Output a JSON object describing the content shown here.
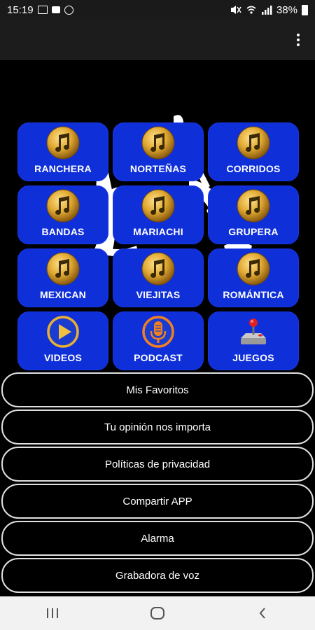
{
  "status_bar": {
    "time": "15:19",
    "battery": "38%"
  },
  "background": {
    "art_color": "#ffffff"
  },
  "tiles": [
    {
      "label": "RANCHERA",
      "icon": "music-note-icon"
    },
    {
      "label": "NORTEÑAS",
      "icon": "music-note-icon"
    },
    {
      "label": "CORRIDOS",
      "icon": "music-note-icon"
    },
    {
      "label": "BANDAS",
      "icon": "music-note-icon"
    },
    {
      "label": "MARIACHI",
      "icon": "music-note-icon"
    },
    {
      "label": "GRUPERA",
      "icon": "music-note-icon"
    },
    {
      "label": "MEXICAN",
      "icon": "music-note-icon"
    },
    {
      "label": "VIEJITAS",
      "icon": "music-note-icon"
    },
    {
      "label": "ROMÁNTICA",
      "icon": "music-note-icon"
    },
    {
      "label": "VIDEOS",
      "icon": "play-icon"
    },
    {
      "label": "PODCAST",
      "icon": "microphone-icon"
    },
    {
      "label": "JUEGOS",
      "icon": "joystick-icon"
    }
  ],
  "menu": [
    {
      "label": "Mis Favoritos"
    },
    {
      "label": "Tu opinión nos importa"
    },
    {
      "label": "Políticas de privacidad"
    },
    {
      "label": "Compartir APP"
    },
    {
      "label": "Alarma"
    },
    {
      "label": "Grabadora de voz"
    }
  ],
  "colors": {
    "tile_blue": "#0f2fd9",
    "gold": "#d4a020",
    "background": "#000000"
  }
}
